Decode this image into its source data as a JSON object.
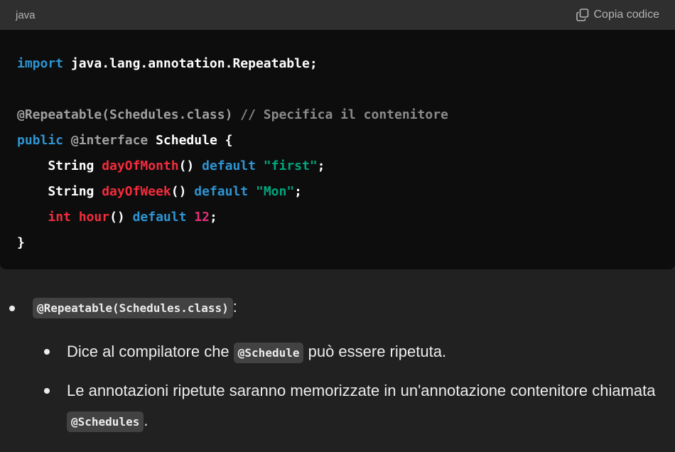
{
  "code_header": {
    "language": "java",
    "copy_label": "Copia codice"
  },
  "code": {
    "l1_kw": "import",
    "l1_rest": " java.lang.annotation.Repeatable;",
    "l3_ann": "@Repeatable(Schedules.class)",
    "l3_cmt": " // Specifica il contenitore",
    "l4_kw": "public",
    "l4_ann": " @interface",
    "l4_rest": " Schedule {",
    "l5_type": "    String ",
    "l5_fn": "dayOfMonth",
    "l5_paren": "() ",
    "l5_kw": "default",
    "l5_str": " \"first\"",
    "l5_end": ";",
    "l6_type": "    String ",
    "l6_fn": "dayOfWeek",
    "l6_paren": "() ",
    "l6_kw": "default",
    "l6_str": " \"Mon\"",
    "l6_end": ";",
    "l7_indent": "    ",
    "l7_type": "int",
    "l7_fn": " hour",
    "l7_paren": "() ",
    "l7_kw": "default",
    "l7_num": " 12",
    "l7_end": ";",
    "l8": "}"
  },
  "explanation": {
    "item1_code": "@Repeatable(Schedules.class)",
    "item1_suffix": ":",
    "sub1_pre": "Dice al compilatore che ",
    "sub1_code": "@Schedule",
    "sub1_post": " può essere ripetuta.",
    "sub2_pre": "Le annotazioni ripetute saranno memorizzate in un'annotazione contenitore chiamata ",
    "sub2_code": "@Schedules",
    "sub2_post": "."
  }
}
